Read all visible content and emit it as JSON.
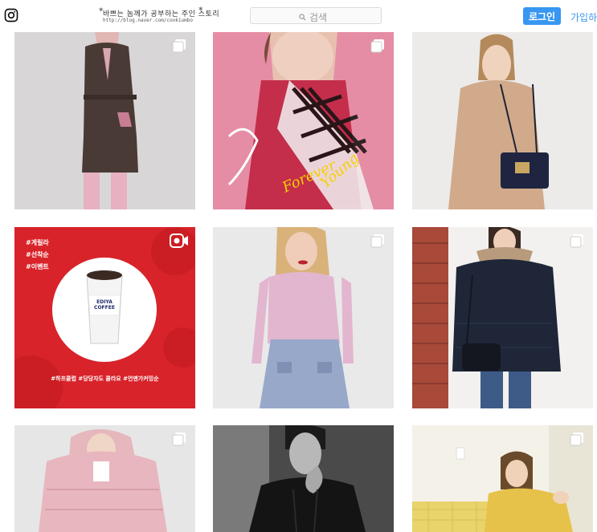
{
  "header": {
    "app_icon": "instagram-icon",
    "blog_watermark": {
      "line1": "바쁘는 놈께가 공부하는 주인 스토리",
      "line2": "http://blog.naver.com/cook1umbo"
    },
    "search": {
      "placeholder": "검색",
      "icon": "search-icon"
    },
    "login_label": "로그인",
    "signup_label": "가입하"
  },
  "grid": {
    "tiles": [
      {
        "badge": "multi-post-icon",
        "alt": "woman in long brown coat and pink trousers"
      },
      {
        "badge": "multi-post-icon",
        "alt": "woman in plaid scarf",
        "overlay_text": "Forever Young"
      },
      {
        "badge": "none",
        "alt": "woman with navy shoulder bag"
      },
      {
        "badge": "video-icon",
        "alt": "EDIYA coffee event",
        "hashtags": [
          "#게릴라",
          "#선착순",
          "#이벤트"
        ],
        "cup_text": "EDIYA COFFEE",
        "bottom_text": "#하프클럽  #당당자도 쿨라요  #언맨가커밍순"
      },
      {
        "badge": "multi-post-icon",
        "alt": "woman in pink turtleneck and denim skirt"
      },
      {
        "badge": "multi-post-icon",
        "alt": "woman in navy quilted jacket"
      },
      {
        "badge": "multi-post-icon",
        "alt": "woman in pink puffer jacket"
      },
      {
        "badge": "none",
        "alt": "man in black padded vest"
      },
      {
        "badge": "multi-post-icon",
        "alt": "woman in yellow sweater on sofa"
      }
    ]
  },
  "colors": {
    "accent": "#3897f0",
    "ediya_red": "#d8232a"
  }
}
